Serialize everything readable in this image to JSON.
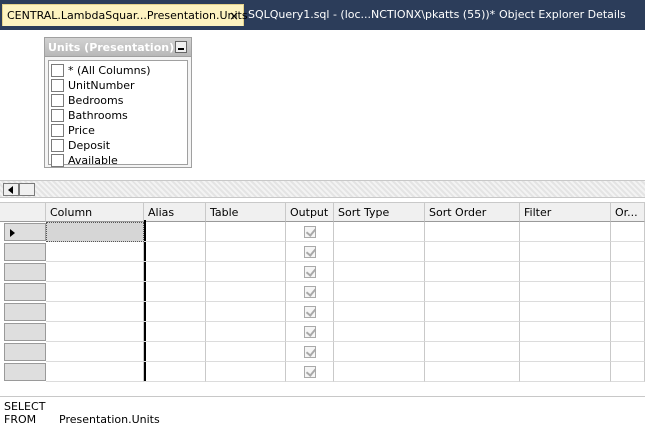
{
  "tabs": [
    {
      "label": "CENTRAL.LambdaSquar...Presentation.Units",
      "close": "×"
    },
    {
      "label": "SQLQuery1.sql - (loc...NCTIONX\\pkatts (55))*"
    },
    {
      "label": "Object Explorer Details"
    }
  ],
  "diagram": {
    "table_title": "Units (Presentation)",
    "columns": [
      "* (All Columns)",
      "UnitNumber",
      "Bedrooms",
      "Bathrooms",
      "Price",
      "Deposit",
      "Available"
    ]
  },
  "grid": {
    "headers": [
      "Column",
      "Alias",
      "Table",
      "Output",
      "Sort Type",
      "Sort Order",
      "Filter",
      "Or..."
    ],
    "row_count": 8
  },
  "sql": {
    "line1": "SELECT",
    "line2_kw": "FROM",
    "line2_val": "Presentation.Units"
  }
}
